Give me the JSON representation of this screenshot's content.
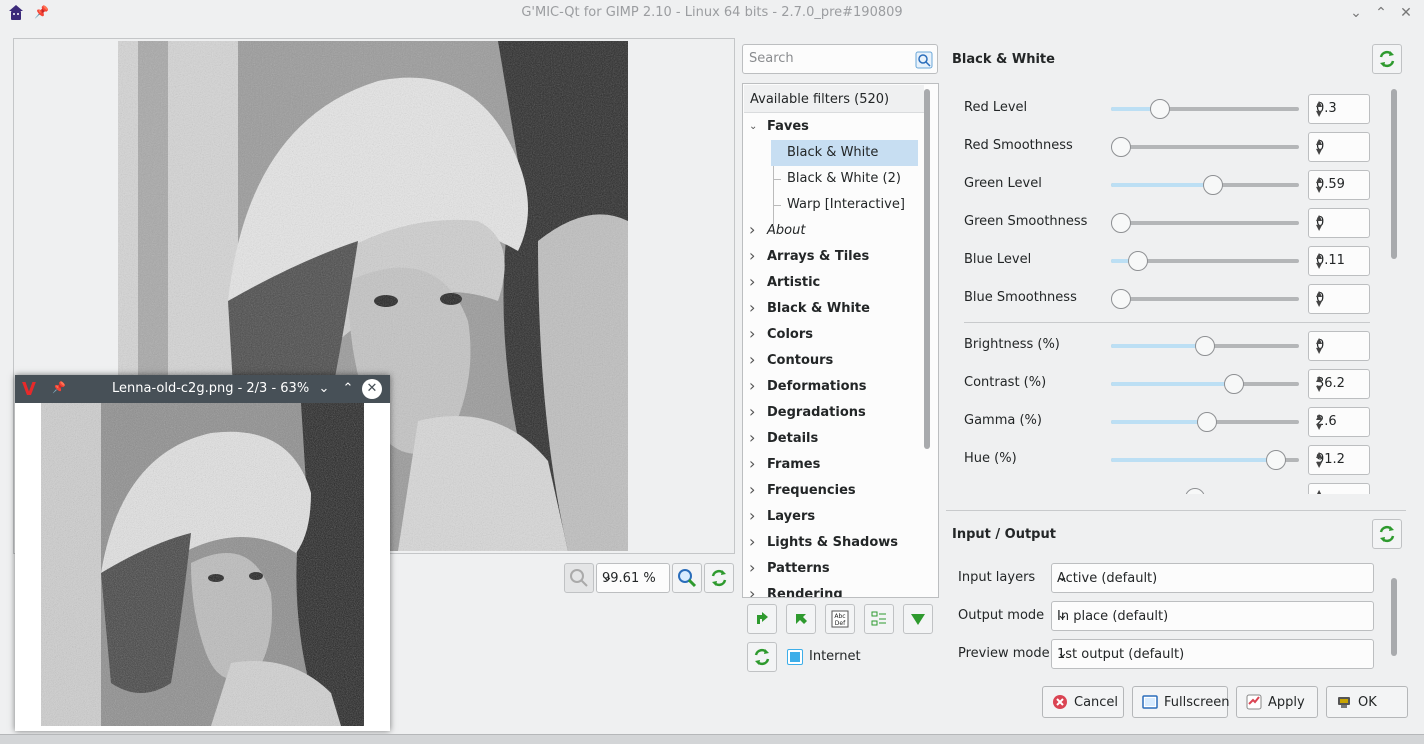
{
  "window": {
    "title": "G'MIC-Qt for GIMP 2.10 - Linux 64 bits - 2.7.0_pre#190809"
  },
  "preview": {
    "zoom_value": "99.61 %"
  },
  "viewer": {
    "title": "Lenna-old-c2g.png - 2/3 - 63%"
  },
  "filters": {
    "search_placeholder": "Search",
    "header": "Available filters (520)",
    "items": [
      {
        "label": "Faves",
        "bold": true,
        "expanded": true,
        "level": 0
      },
      {
        "label": "Black & White",
        "bold": false,
        "level": 1,
        "selected": true
      },
      {
        "label": "Black & White (2)",
        "bold": false,
        "level": 1
      },
      {
        "label": "Warp [Interactive]",
        "bold": false,
        "level": 1
      },
      {
        "label": "About",
        "italic": true,
        "level": 0
      },
      {
        "label": "Arrays & Tiles",
        "bold": true,
        "level": 0
      },
      {
        "label": "Artistic",
        "bold": true,
        "level": 0
      },
      {
        "label": "Black & White",
        "bold": true,
        "level": 0
      },
      {
        "label": "Colors",
        "bold": true,
        "level": 0
      },
      {
        "label": "Contours",
        "bold": true,
        "level": 0
      },
      {
        "label": "Deformations",
        "bold": true,
        "level": 0
      },
      {
        "label": "Degradations",
        "bold": true,
        "level": 0
      },
      {
        "label": "Details",
        "bold": true,
        "level": 0
      },
      {
        "label": "Frames",
        "bold": true,
        "level": 0
      },
      {
        "label": "Frequencies",
        "bold": true,
        "level": 0
      },
      {
        "label": "Layers",
        "bold": true,
        "level": 0
      },
      {
        "label": "Lights & Shadows",
        "bold": true,
        "level": 0
      },
      {
        "label": "Patterns",
        "bold": true,
        "level": 0
      },
      {
        "label": "Rendering",
        "bold": true,
        "level": 0
      }
    ],
    "internet_label": "Internet",
    "internet_checked": true
  },
  "params": {
    "title": "Black & White",
    "items": [
      {
        "label": "Red Level",
        "value": "0.3",
        "fraction": 0.23
      },
      {
        "label": "Red Smoothness",
        "value": "0",
        "fraction": 0.0
      },
      {
        "label": "Green Level",
        "value": "0.59",
        "fraction": 0.55
      },
      {
        "label": "Green Smoothness",
        "value": "0",
        "fraction": 0.0
      },
      {
        "label": "Blue Level",
        "value": "0.11",
        "fraction": 0.1
      },
      {
        "label": "Blue Smoothness",
        "value": "0",
        "fraction": 0.0
      },
      {
        "label": "Brightness (%)",
        "value": "0",
        "fraction": 0.5
      },
      {
        "label": "Contrast (%)",
        "value": "36.2",
        "fraction": 0.67
      },
      {
        "label": "Gamma (%)",
        "value": "2.6",
        "fraction": 0.51
      },
      {
        "label": "Hue (%)",
        "value": "91.2",
        "fraction": 0.92
      },
      {
        "label": "",
        "value": "",
        "fraction": 0.44
      }
    ]
  },
  "io": {
    "title": "Input / Output",
    "rows": [
      {
        "label": "Input layers",
        "value": "Active (default)"
      },
      {
        "label": "Output mode",
        "value": "In place (default)"
      },
      {
        "label": "Preview mode",
        "value": "1st output (default)"
      }
    ]
  },
  "buttons": {
    "cancel": "Cancel",
    "fullscreen": "Fullscreen",
    "apply": "Apply",
    "ok": "OK"
  },
  "colors": {
    "accent": "#3daee9",
    "selection": "#c7def2",
    "slider_fill": "#bcdff4",
    "reset_green": "#2e9a2e"
  }
}
